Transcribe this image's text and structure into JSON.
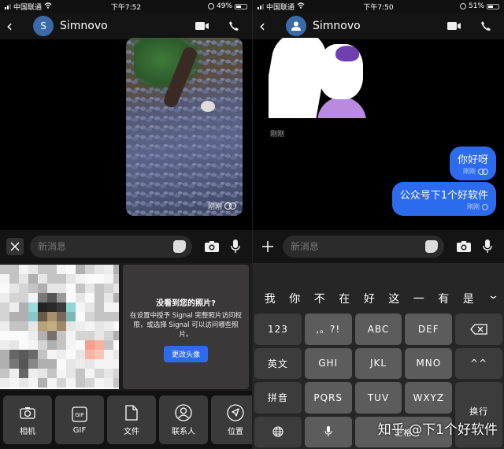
{
  "left": {
    "status": {
      "carrier": "中国联通",
      "time": "下午7:52",
      "battery": "49%",
      "battery_level": 0.49
    },
    "header": {
      "avatar_initial": "S",
      "contact_name": "Simnovo"
    },
    "media_message": {
      "time": "刚刚",
      "status": "delivered"
    },
    "composer": {
      "placeholder": "新消息"
    },
    "permission_card": {
      "title": "没看到您的照片?",
      "body": "在设置中授予 Signal 完整照片访问权限，或选择 Signal 可以访问哪些照片。",
      "button_label": "更改头像"
    },
    "attach_bar": [
      {
        "label": "相机",
        "icon": "camera-icon"
      },
      {
        "label": "GIF",
        "icon": "gif-icon"
      },
      {
        "label": "文件",
        "icon": "file-icon"
      },
      {
        "label": "联系人",
        "icon": "contact-icon"
      },
      {
        "label": "位置",
        "icon": "location-icon"
      }
    ]
  },
  "right": {
    "status": {
      "carrier": "中国联通",
      "time": "下午7:50",
      "battery": "51%",
      "battery_level": 0.51
    },
    "header": {
      "contact_name": "Simnovo"
    },
    "sticker_message": {
      "time": "刚刚"
    },
    "messages": [
      {
        "text": "你好呀",
        "time": "刚刚",
        "status": "delivered"
      },
      {
        "text": "公众号下1个好软件",
        "time": "刚刚",
        "status": "sending"
      }
    ],
    "composer": {
      "placeholder": "新消息"
    },
    "keyboard": {
      "candidates": [
        "我",
        "你",
        "不",
        "在",
        "好",
        "这",
        "一",
        "有",
        "是"
      ],
      "toggle": "⌄",
      "rows": [
        [
          "123",
          ",。?!",
          "ABC",
          "DEF",
          "⌫"
        ],
        [
          "英文",
          "GHI",
          "JKL",
          "MNO",
          "^^"
        ],
        [
          "拼音",
          "PQRS",
          "TUV",
          "WXYZ",
          "换行"
        ],
        [
          "🌐",
          "🎤",
          "空格"
        ]
      ]
    }
  },
  "watermark": "知乎 @下1个好软件",
  "colors": {
    "accent": "#2c6bed",
    "avatar": "#3a6aa8",
    "key": "#5c5c5c",
    "key_dark": "#3c3c3c"
  }
}
